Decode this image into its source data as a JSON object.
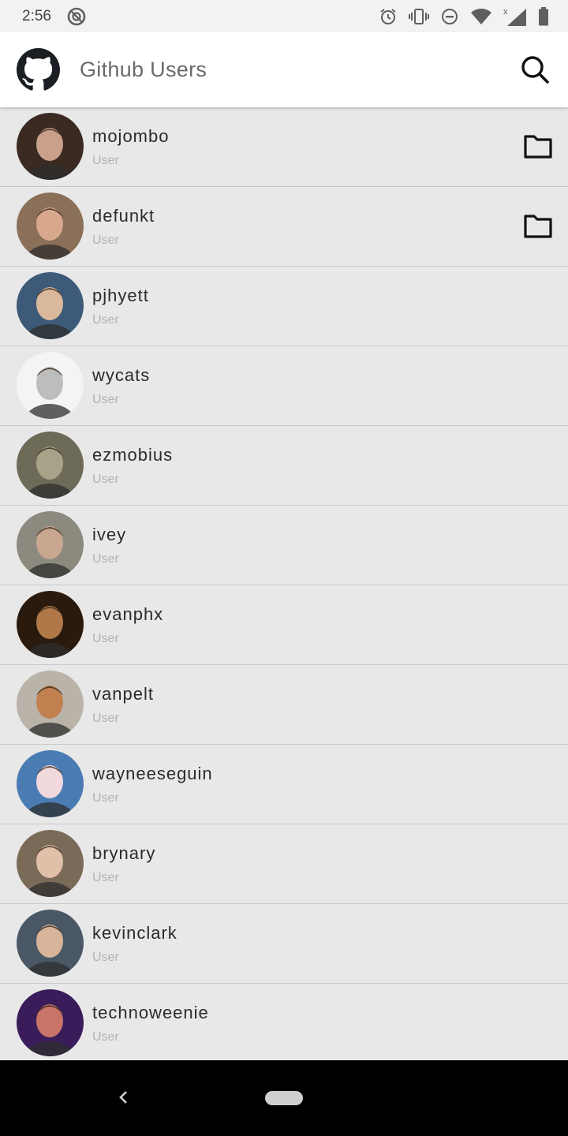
{
  "status_bar": {
    "time": "2:56",
    "icons": [
      "no-sim-app-icon",
      "alarm-icon",
      "vibrate-icon",
      "do-not-disturb-icon",
      "wifi-icon",
      "signal-icon",
      "battery-icon"
    ]
  },
  "app_bar": {
    "title": "Github Users",
    "logo_icon": "github-logo-icon",
    "search_icon": "search-icon"
  },
  "users": [
    {
      "login": "mojombo",
      "type": "User",
      "has_folder": true,
      "avatar_bg": "#3a2a22",
      "skin": "#c9a08a"
    },
    {
      "login": "defunkt",
      "type": "User",
      "has_folder": true,
      "avatar_bg": "#8a7058",
      "skin": "#d7a88c"
    },
    {
      "login": "pjhyett",
      "type": "User",
      "has_folder": false,
      "avatar_bg": "#3d5a78",
      "skin": "#d9b89c"
    },
    {
      "login": "wycats",
      "type": "User",
      "has_folder": false,
      "avatar_bg": "#f4f4f4",
      "skin": "#bdbdbd"
    },
    {
      "login": "ezmobius",
      "type": "User",
      "has_folder": false,
      "avatar_bg": "#6d6a58",
      "skin": "#a8a288"
    },
    {
      "login": "ivey",
      "type": "User",
      "has_folder": false,
      "avatar_bg": "#8c8a7e",
      "skin": "#c8a690"
    },
    {
      "login": "evanphx",
      "type": "User",
      "has_folder": false,
      "avatar_bg": "#2a1a0e",
      "skin": "#b07848"
    },
    {
      "login": "vanpelt",
      "type": "User",
      "has_folder": false,
      "avatar_bg": "#b9b3a9",
      "skin": "#c28050"
    },
    {
      "login": "wayneeseguin",
      "type": "User",
      "has_folder": false,
      "avatar_bg": "#4a7cb3",
      "skin": "#f0d8dc"
    },
    {
      "login": "brynary",
      "type": "User",
      "has_folder": false,
      "avatar_bg": "#7a6a58",
      "skin": "#e0c0a8"
    },
    {
      "login": "kevinclark",
      "type": "User",
      "has_folder": false,
      "avatar_bg": "#4a5866",
      "skin": "#d8b49a"
    },
    {
      "login": "technoweenie",
      "type": "User",
      "has_folder": false,
      "avatar_bg": "#3a1c5a",
      "skin": "#c87468"
    }
  ],
  "nav_bar": {
    "back_icon": "back-chevron-icon",
    "home_icon": "home-pill-icon"
  }
}
